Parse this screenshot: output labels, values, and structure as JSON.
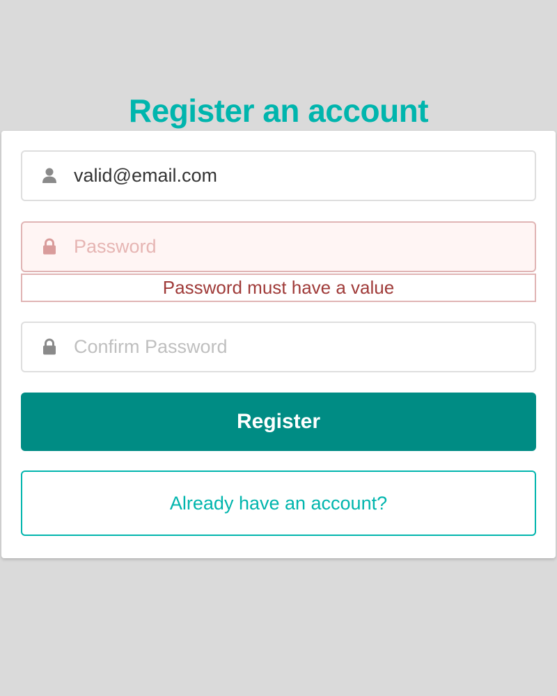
{
  "page": {
    "title": "Register an account"
  },
  "form": {
    "email": {
      "value": "valid@email.com",
      "icon": "user-icon"
    },
    "password": {
      "placeholder": "Password",
      "value": "",
      "icon": "lock-icon",
      "error": "Password must have a value"
    },
    "confirm_password": {
      "placeholder": "Confirm Password",
      "value": "",
      "icon": "lock-icon"
    },
    "register_label": "Register",
    "login_link_label": "Already have an account?"
  },
  "colors": {
    "accent": "#00b5ad",
    "primary_button": "#008c84",
    "error_text": "#9f3a38",
    "error_border": "#e0b4b4",
    "error_background": "#fff5f4",
    "page_background": "#dadada"
  }
}
